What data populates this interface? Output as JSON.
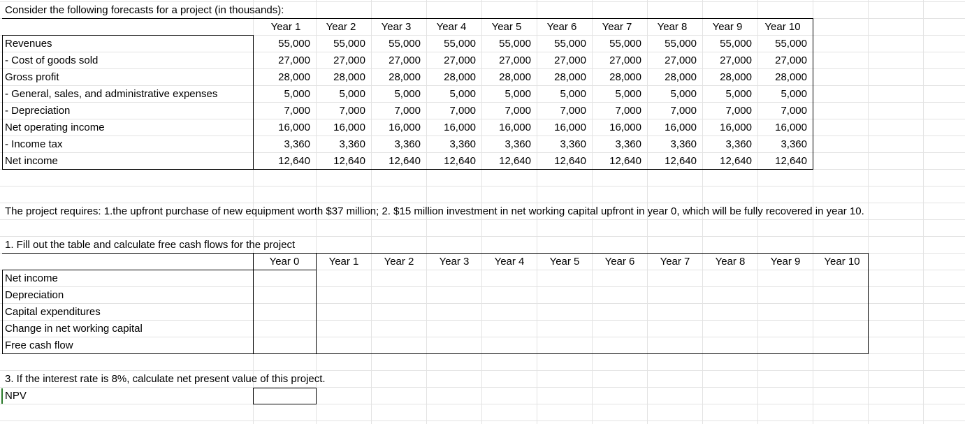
{
  "intro": "Consider the following forecasts for a project (in thousands):",
  "years": [
    "Year 1",
    "Year 2",
    "Year 3",
    "Year 4",
    "Year 5",
    "Year 6",
    "Year 7",
    "Year 8",
    "Year 9",
    "Year 10"
  ],
  "forecast_rows": [
    {
      "label": "Revenues",
      "values": [
        "55,000",
        "55,000",
        "55,000",
        "55,000",
        "55,000",
        "55,000",
        "55,000",
        "55,000",
        "55,000",
        "55,000"
      ]
    },
    {
      "label": "- Cost of goods sold",
      "values": [
        "27,000",
        "27,000",
        "27,000",
        "27,000",
        "27,000",
        "27,000",
        "27,000",
        "27,000",
        "27,000",
        "27,000"
      ]
    },
    {
      "label": "Gross profit",
      "values": [
        "28,000",
        "28,000",
        "28,000",
        "28,000",
        "28,000",
        "28,000",
        "28,000",
        "28,000",
        "28,000",
        "28,000"
      ]
    },
    {
      "label": "- General, sales, and administrative expenses",
      "values": [
        "5,000",
        "5,000",
        "5,000",
        "5,000",
        "5,000",
        "5,000",
        "5,000",
        "5,000",
        "5,000",
        "5,000"
      ]
    },
    {
      "label": "- Depreciation",
      "values": [
        "7,000",
        "7,000",
        "7,000",
        "7,000",
        "7,000",
        "7,000",
        "7,000",
        "7,000",
        "7,000",
        "7,000"
      ]
    },
    {
      "label": "Net operating income",
      "values": [
        "16,000",
        "16,000",
        "16,000",
        "16,000",
        "16,000",
        "16,000",
        "16,000",
        "16,000",
        "16,000",
        "16,000"
      ]
    },
    {
      "label": "- Income tax",
      "values": [
        "3,360",
        "3,360",
        "3,360",
        "3,360",
        "3,360",
        "3,360",
        "3,360",
        "3,360",
        "3,360",
        "3,360"
      ]
    },
    {
      "label": "Net income",
      "values": [
        "12,640",
        "12,640",
        "12,640",
        "12,640",
        "12,640",
        "12,640",
        "12,640",
        "12,640",
        "12,640",
        "12,640"
      ]
    }
  ],
  "requirements": "The project requires: 1.the upfront purchase of new equipment worth $37 million; 2. $15 million investment in net working capital upfront in year 0, which will be fully recovered in year 10.",
  "q1": "1. Fill out the table and calculate free cash flows for the project",
  "fcf_years": [
    "Year 0",
    "Year 1",
    "Year 2",
    "Year 3",
    "Year 4",
    "Year 5",
    "Year 6",
    "Year 7",
    "Year 8",
    "Year 9",
    "Year 10"
  ],
  "fcf_rows": [
    "Net income",
    "Depreciation",
    "Capital expenditures",
    "Change in net working capital",
    "Free cash flow"
  ],
  "q3": "3. If the interest rate is 8%, calculate net present value of this project.",
  "npv_label": "NPV"
}
